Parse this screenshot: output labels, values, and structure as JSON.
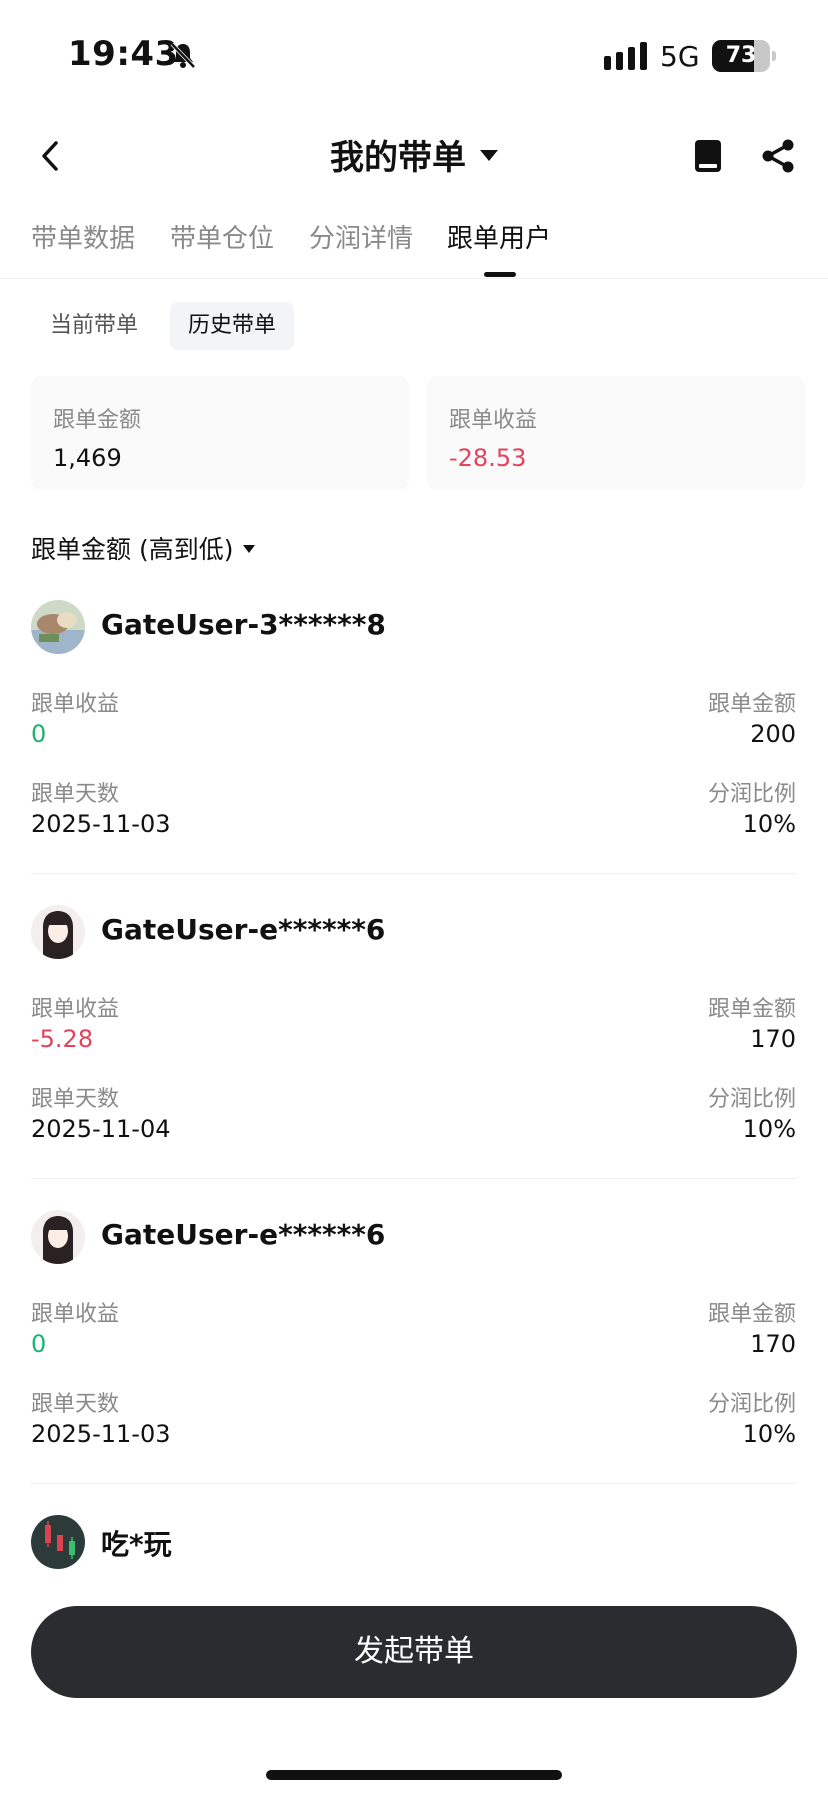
{
  "status_bar": {
    "time": "19:43",
    "network": "5G",
    "battery": "73",
    "battery_level": 0.73
  },
  "nav": {
    "title": "我的带单"
  },
  "tabs": [
    {
      "label": "带单数据",
      "active": false
    },
    {
      "label": "带单仓位",
      "active": false
    },
    {
      "label": "分润详情",
      "active": false
    },
    {
      "label": "跟单用户",
      "active": true
    }
  ],
  "subtabs": [
    {
      "label": "当前带单",
      "active": false
    },
    {
      "label": "历史带单",
      "active": true
    }
  ],
  "summary": {
    "amount_label": "跟单金额",
    "amount_value": "1,469",
    "profit_label": "跟单收益",
    "profit_value": "-28.53"
  },
  "sort": {
    "label": "跟单金额 (高到低)"
  },
  "labels": {
    "profit": "跟单收益",
    "amount": "跟单金额",
    "days": "跟单天数",
    "ratio": "分润比例"
  },
  "followers": [
    {
      "name": "GateUser-3******8",
      "profit": "0",
      "profit_sign": "pos",
      "amount": "200",
      "days": "2025-11-03",
      "ratio": "10%"
    },
    {
      "name": "GateUser-e******6",
      "profit": "-5.28",
      "profit_sign": "neg",
      "amount": "170",
      "days": "2025-11-04",
      "ratio": "10%"
    },
    {
      "name": "GateUser-e******6",
      "profit": "0",
      "profit_sign": "pos",
      "amount": "170",
      "days": "2025-11-03",
      "ratio": "10%"
    },
    {
      "name": "吃*玩"
    }
  ],
  "cta": {
    "label": "发起带单"
  },
  "colors": {
    "positive": "#20b26c",
    "negative": "#e2445c",
    "cta_bg": "#2b2c30"
  },
  "icons": [
    "bell-off-icon",
    "signal-icon",
    "battery-icon",
    "back-icon",
    "book-icon",
    "share-icon",
    "caret-down-icon"
  ]
}
